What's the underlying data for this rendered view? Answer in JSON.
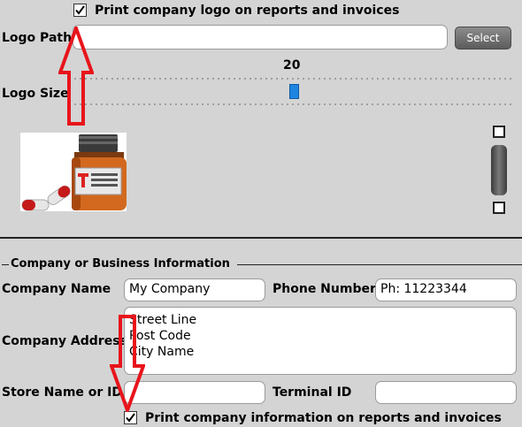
{
  "logo": {
    "print_logo_label": "Print company logo on reports and invoices",
    "print_logo_checked": true,
    "path_label": "Logo Path",
    "path_value": "",
    "select_label": "Select",
    "size_label": "Logo Size",
    "size_value": "20",
    "size_fraction": 0.5
  },
  "company": {
    "section_title": "Company or Business Information",
    "name_label": "Company Name",
    "name_value": "My Company",
    "phone_label": "Phone Number",
    "phone_value": "Ph: 11223344",
    "address_label": "Company Address",
    "address_lines": [
      "Street Line",
      "Post Code",
      "City Name"
    ],
    "store_label": "Store Name or ID",
    "store_value": "",
    "terminal_label": "Terminal ID",
    "terminal_value": "",
    "print_info_label": "Print company information on reports and invoices",
    "print_info_checked": true
  },
  "colors": {
    "arrow": "#e8141b",
    "slider_thumb": "#1f84e0",
    "panel_bg": "#d4d4d4"
  },
  "icons": {
    "logo_image": "medicine-bottle-and-pills-image"
  }
}
